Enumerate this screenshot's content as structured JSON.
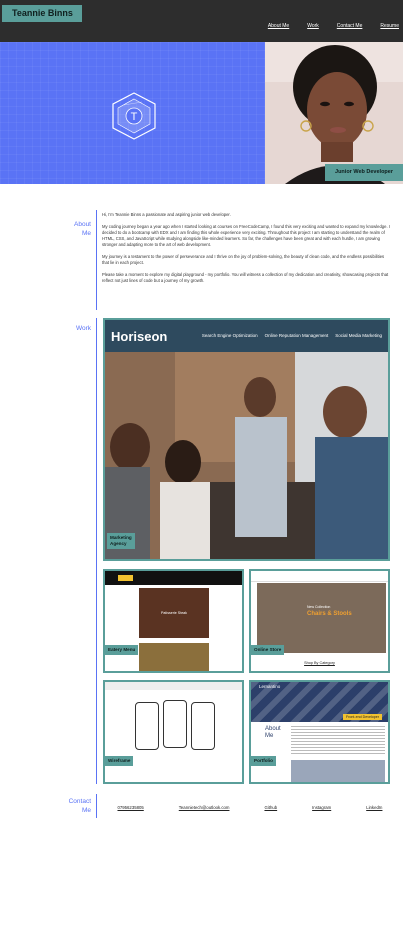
{
  "header": {
    "brand": "Teannie Binns",
    "nav": [
      "About Me",
      "Work",
      "Contact Me",
      "Resume"
    ]
  },
  "hero": {
    "logo_letter": "T",
    "portrait_caption": "Junior Web Developer"
  },
  "about": {
    "label_line1": "About",
    "label_line2": "Me",
    "paragraphs": [
      "Hi, I'm Teannie Binns a passionate and aspiring junior web developer.",
      "My coding journey began a year ago when I started looking at courses on FreeCodeCamp, I found this very exciting and wanted to expand my knowledge. I decided to do a bootcamp with EDX and I am finding this whole experience very exciting. Throughout this project I am starting to understand the realm of HTML, CSS, and JavaScript while studying alongside like-minded learners. So far, the challenges have been great and with each hurdle, I am growing stronger and adapting more to the art of web development.",
      "My journey is a testament to the power of perseverance and I thrive on the joy of problem-solving, the beauty of clean code, and the endless possibilities that lie in each project.",
      "Please take a moment to explore my digital playground - my portfolio. You will witness a collection of my dedication and creativity, showcasing projects that reflect not just lines of code but a journey of my growth."
    ]
  },
  "work": {
    "label": "Work",
    "main": {
      "logo": "Horiseon",
      "nav": [
        "Search Engine Optimization",
        "Online Reputation Management",
        "Social Media Marketing"
      ],
      "label_line1": "Marketing",
      "label_line2": "Agency"
    },
    "cards": [
      {
        "label": "Eatery Menu",
        "inner_title": "Patisserie Steak"
      },
      {
        "label": "Online Store",
        "inner_title": "Chairs & Stools",
        "inner_sub": "New Collection",
        "inner_link": "Shop By Category"
      },
      {
        "label": "Wireframe"
      },
      {
        "label": "Portfolio",
        "inner_brand": "Lernantino",
        "inner_heading": "About Me",
        "inner_badge": "Front-end Developer"
      }
    ]
  },
  "contact": {
    "label_line1": "Contact",
    "label_line2": "Me",
    "links": [
      "07956235805",
      "Teannietech@outlook.com",
      "Github",
      "Instagram",
      "LinkedIn"
    ]
  },
  "colors": {
    "accent_blue": "#5a73f5",
    "accent_teal": "#5a9e9a",
    "header_bg": "#2d2d2d"
  }
}
